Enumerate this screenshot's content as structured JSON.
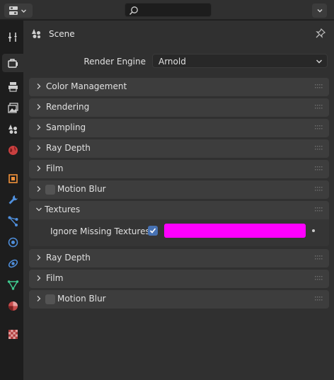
{
  "header": {
    "editor_type_icon": "properties-editor-icon",
    "search_placeholder": "",
    "options_icon": "chevron-down-icon"
  },
  "tabs": [
    {
      "name": "tool-tab",
      "icon": "tool-settings-icon"
    },
    {
      "name": "render-tab",
      "icon": "render-camera-icon",
      "active": true
    },
    {
      "name": "output-tab",
      "icon": "printer-icon"
    },
    {
      "name": "view-layer-tab",
      "icon": "image-stack-icon"
    },
    {
      "name": "scene-tab",
      "icon": "scene-icon"
    },
    {
      "name": "world-tab",
      "icon": "world-icon"
    },
    {
      "name": "object-tab",
      "icon": "object-square-icon"
    },
    {
      "name": "modifier-tab",
      "icon": "wrench-icon"
    },
    {
      "name": "particles-tab",
      "icon": "particles-icon"
    },
    {
      "name": "physics-tab",
      "icon": "physics-icon"
    },
    {
      "name": "constraints-tab",
      "icon": "constraints-icon"
    },
    {
      "name": "data-tab",
      "icon": "mesh-data-icon"
    },
    {
      "name": "material-tab",
      "icon": "material-sphere-icon"
    },
    {
      "name": "texture-tab",
      "icon": "checker-texture-icon"
    }
  ],
  "context": {
    "label": "Scene"
  },
  "render_engine": {
    "label": "Render Engine",
    "value": "Arnold"
  },
  "panels": [
    {
      "title": "Color Management",
      "expanded": false,
      "checkbox": false
    },
    {
      "title": "Rendering",
      "expanded": false,
      "checkbox": false
    },
    {
      "title": "Sampling",
      "expanded": false,
      "checkbox": false
    },
    {
      "title": "Ray Depth",
      "expanded": false,
      "checkbox": false
    },
    {
      "title": "Film",
      "expanded": false,
      "checkbox": false
    },
    {
      "title": "Motion Blur",
      "expanded": false,
      "checkbox": true
    },
    {
      "title": "Textures",
      "expanded": true,
      "checkbox": false
    },
    {
      "title": "Ray Depth",
      "expanded": false,
      "checkbox": false
    },
    {
      "title": "Film",
      "expanded": false,
      "checkbox": false
    },
    {
      "title": "Motion Blur",
      "expanded": false,
      "checkbox": true
    }
  ],
  "textures": {
    "ignore_missing_label": "Ignore Missing Textures",
    "ignore_missing_checked": true,
    "missing_color": "#ff00ff"
  },
  "colors": {
    "accent": "#4772b3",
    "panel_header": "#3d3d3d",
    "background": "#303030"
  }
}
